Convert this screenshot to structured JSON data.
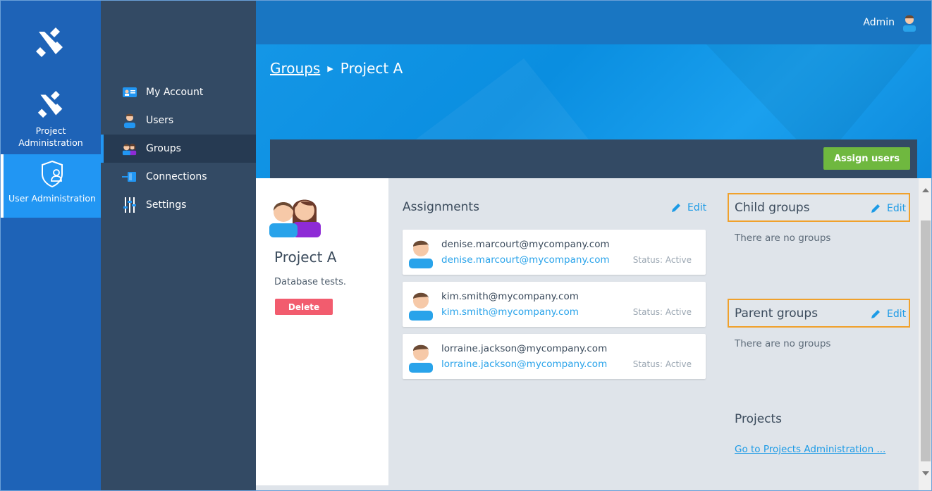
{
  "header": {
    "user_label": "Admin"
  },
  "rail": {
    "project_label_line1": "Project",
    "project_label_line2": "Administration",
    "user_admin_label": "User Administration"
  },
  "nav": {
    "items": [
      {
        "label": "My Account",
        "icon": "account-card-icon"
      },
      {
        "label": "Users",
        "icon": "user-icon"
      },
      {
        "label": "Groups",
        "icon": "groups-icon",
        "active": true
      },
      {
        "label": "Connections",
        "icon": "connections-icon"
      },
      {
        "label": "Settings",
        "icon": "sliders-icon"
      }
    ]
  },
  "breadcrumb": {
    "parent": "Groups",
    "current": "Project A"
  },
  "toolbar": {
    "assign_label": "Assign users"
  },
  "group": {
    "name": "Project A",
    "description": "Database tests.",
    "delete_label": "Delete"
  },
  "assignments": {
    "title": "Assignments",
    "edit_label": "Edit",
    "rows": [
      {
        "email": "denise.marcourt@mycompany.com",
        "email_link": "denise.marcourt@mycompany.com",
        "status": "Status: Active"
      },
      {
        "email": "kim.smith@mycompany.com",
        "email_link": "kim.smith@mycompany.com",
        "status": "Status: Active"
      },
      {
        "email": "lorraine.jackson@mycompany.com",
        "email_link": "lorraine.jackson@mycompany.com",
        "status": "Status: Active"
      }
    ]
  },
  "child_groups": {
    "title": "Child groups",
    "edit_label": "Edit",
    "empty": "There are no groups"
  },
  "parent_groups": {
    "title": "Parent groups",
    "edit_label": "Edit",
    "empty": "There are no groups"
  },
  "projects": {
    "title": "Projects",
    "link": "Go to Projects Administration ..."
  },
  "colors": {
    "accent": "#2196f3",
    "assign_button": "#6fb83f",
    "delete_button": "#f25c6e",
    "highlight": "#f0a12c"
  }
}
